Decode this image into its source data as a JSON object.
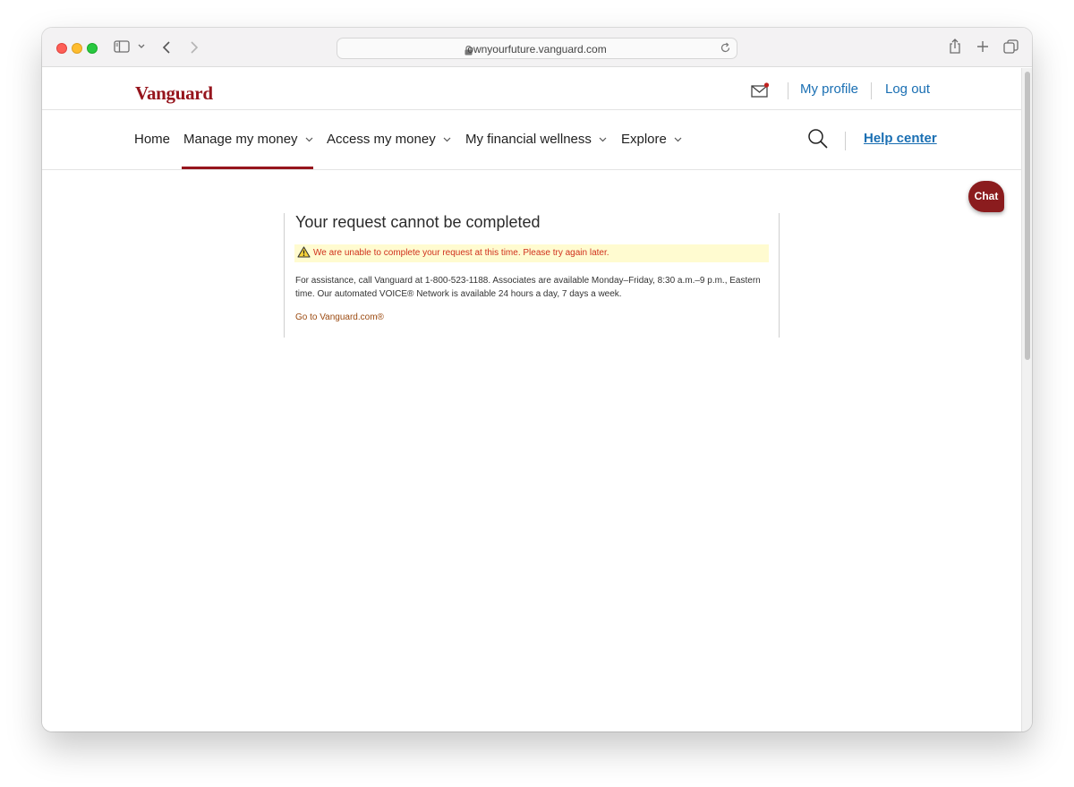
{
  "browser": {
    "url": "ownyourfuture.vanguard.com"
  },
  "header": {
    "logo": "Vanguard",
    "my_profile": "My profile",
    "log_out": "Log out"
  },
  "nav": {
    "items": [
      {
        "label": "Home"
      },
      {
        "label": "Manage my money"
      },
      {
        "label": "Access my money"
      },
      {
        "label": "My financial wellness"
      },
      {
        "label": "Explore"
      }
    ],
    "help_center": "Help center"
  },
  "chat": {
    "label": "Chat"
  },
  "error": {
    "title": "Your request cannot be completed",
    "alert": "We are unable to complete your request at this time. Please try again later.",
    "assist_line1": "For assistance, call Vanguard at 1-800-523-1188. Associates are available Monday–Friday, 8:30 a.m.–9 p.m., Eastern",
    "assist_line2": "time. Our automated VOICE® Network is available 24 hours a day, 7 days a week.",
    "link": "Go to Vanguard.com®"
  },
  "colors": {
    "brand": "#96151d",
    "link": "#1a6fb3",
    "alert_bg": "#fffbd0",
    "alert_text": "#d0311d"
  }
}
